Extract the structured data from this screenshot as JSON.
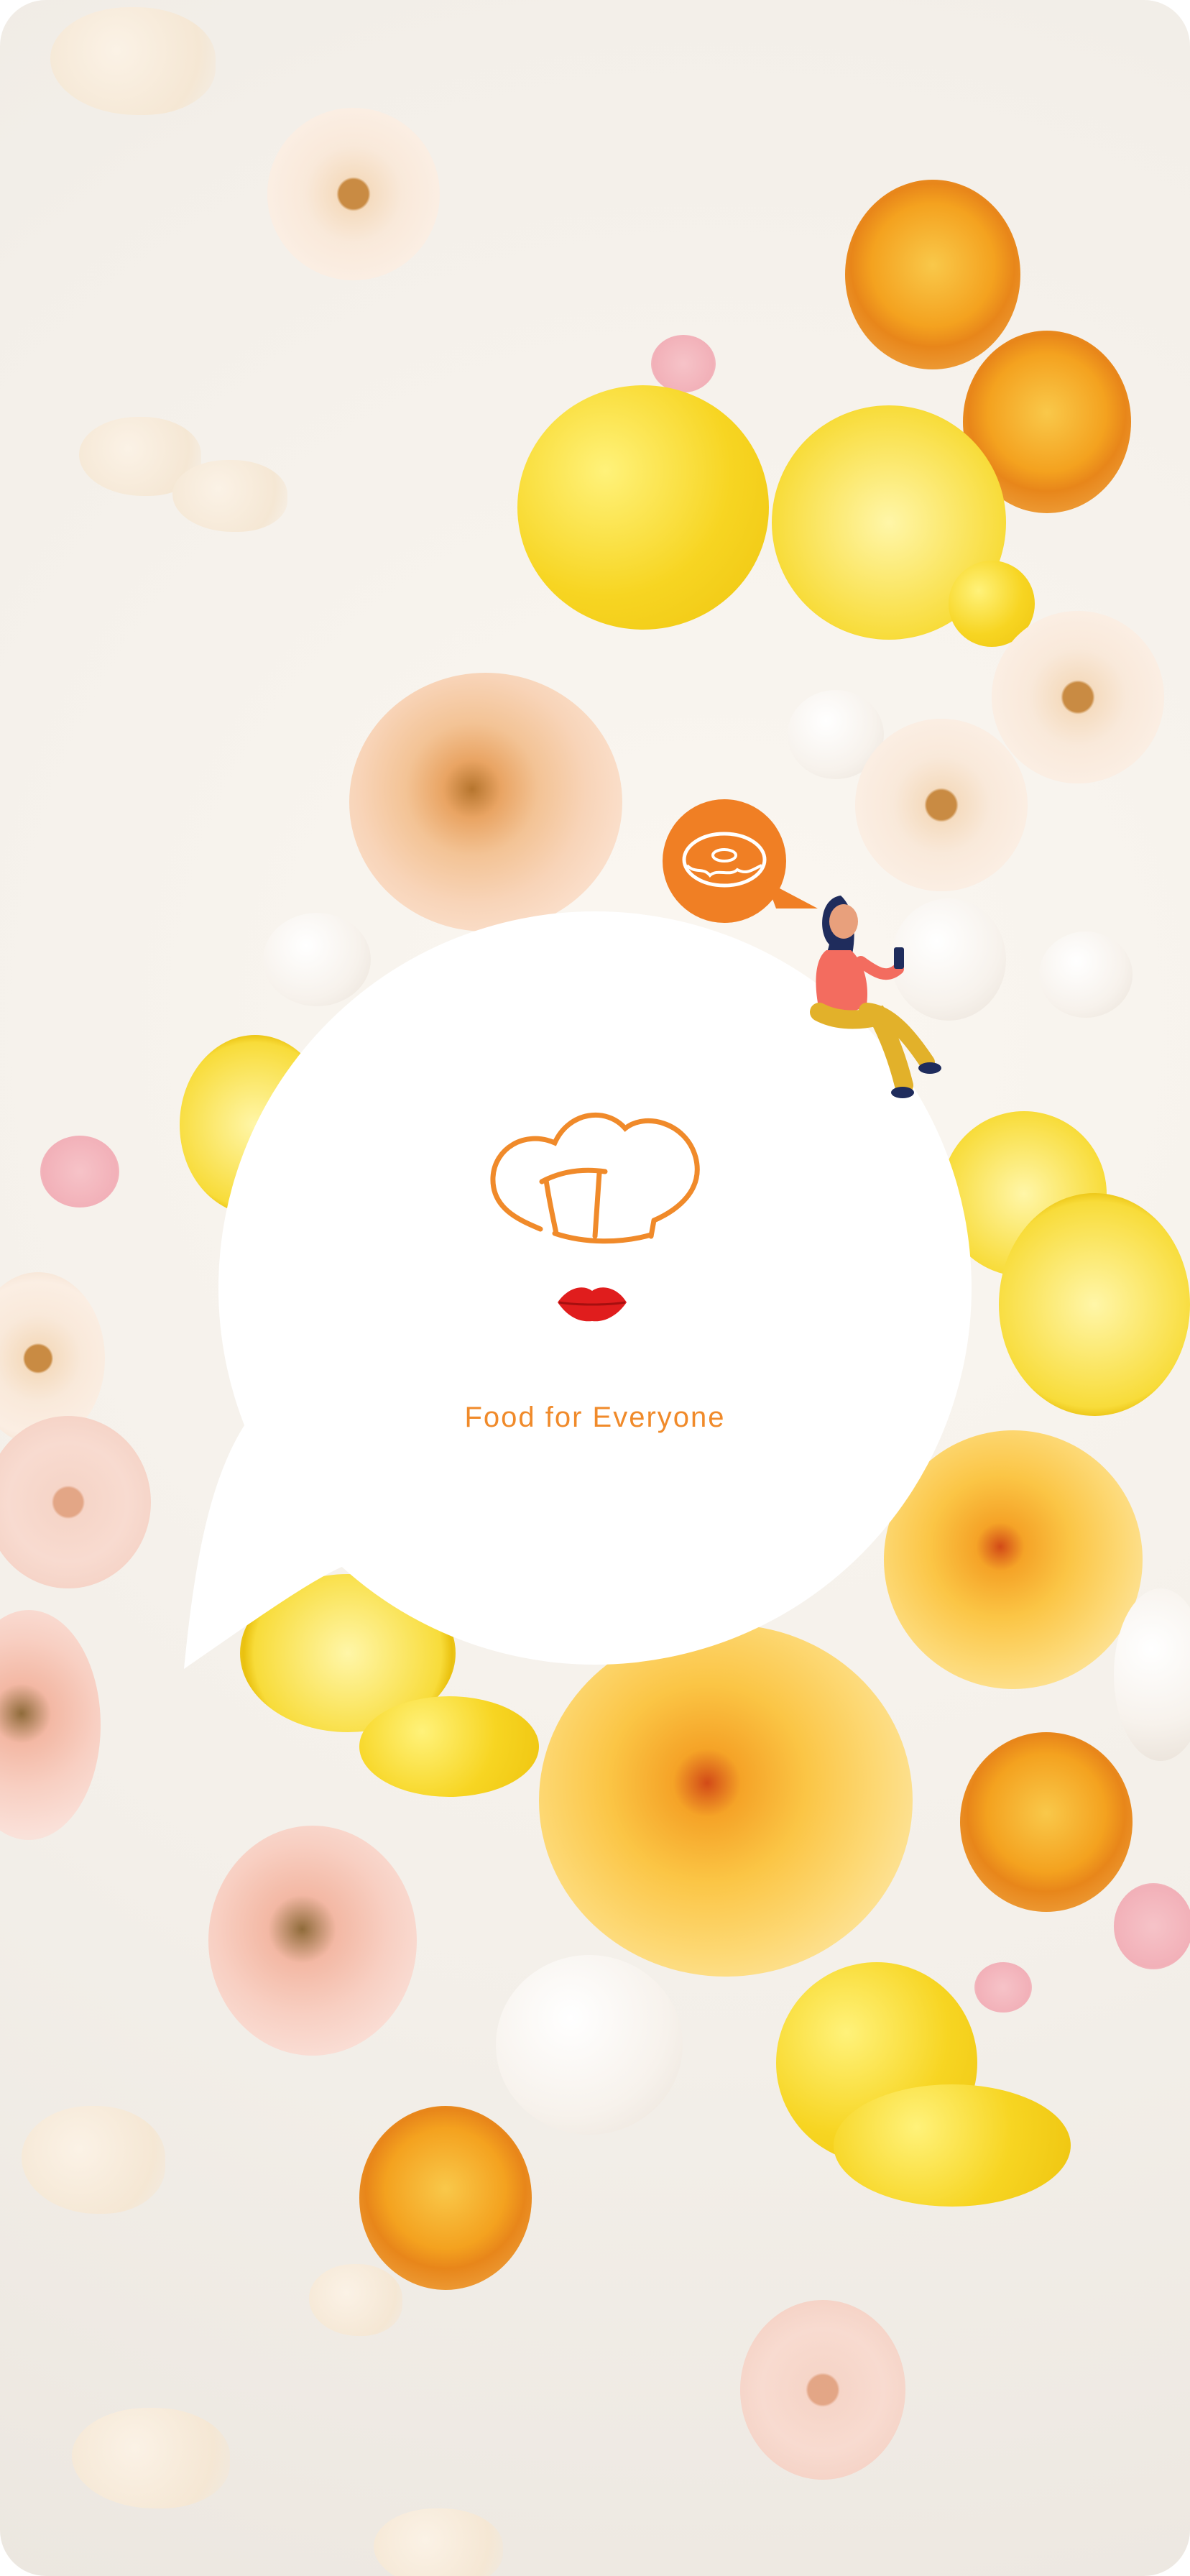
{
  "app": {
    "tagline": "Food for Everyone"
  },
  "icons": {
    "logo": "chef-hat-lips-logo-icon",
    "donut_bubble": "donut-speech-bubble-icon",
    "illustration": "woman-with-phone-illustration"
  },
  "colors": {
    "brand_orange": "#f08a2a",
    "lips_red": "#e01d1d",
    "bubble_white": "#ffffff",
    "background": "#f3efe9"
  }
}
